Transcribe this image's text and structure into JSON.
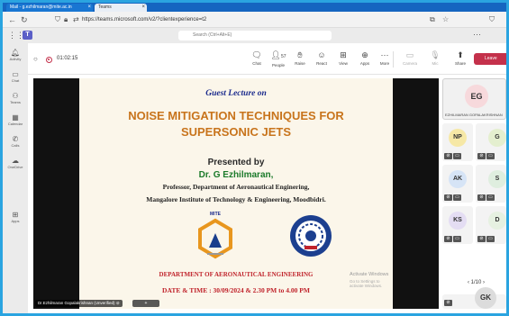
{
  "browser": {
    "tabs": [
      {
        "label": "Mail - g.ezhilmaran@mite.ac.in"
      },
      {
        "label": "Teams"
      }
    ],
    "url": "https://teams.microsoft.com/v2/?clientexperience=t2"
  },
  "teams": {
    "search_placeholder": "Search (Ctrl+Alt+E)",
    "rail": [
      {
        "label": "Activity",
        "icon": "bell-icon"
      },
      {
        "label": "Chat",
        "icon": "chat-icon"
      },
      {
        "label": "Teams",
        "icon": "teams-icon"
      },
      {
        "label": "Calendar",
        "icon": "calendar-icon"
      },
      {
        "label": "Calls",
        "icon": "phone-icon"
      },
      {
        "label": "OneDrive",
        "icon": "cloud-icon"
      },
      {
        "label": "Apps",
        "icon": "apps-icon"
      }
    ]
  },
  "meeting": {
    "timer": "01:02:15",
    "toolbar": {
      "chat": "Chat",
      "people": "People",
      "people_count": "57",
      "raise": "Raise",
      "react": "React",
      "view": "View",
      "apps": "Apps",
      "more": "More",
      "camera": "Camera",
      "mic": "Mic",
      "share": "Share",
      "leave": "Leave"
    },
    "presenter_label": "Dr.Ezhilmaran Gopalakrishnan (Unverified)",
    "stage_controls": "+",
    "participants": [
      {
        "initials": "EG",
        "name": "EZHILMARAN GOPALAKRISHNAN",
        "color": "#f7d9dc"
      },
      {
        "initials": "NP",
        "color": "#f6e8a6"
      },
      {
        "initials": "G",
        "color": "#e4efcf"
      },
      {
        "initials": "AK",
        "color": "#d6e4f6"
      },
      {
        "initials": "S",
        "color": "#dfeedf"
      },
      {
        "initials": "KS",
        "color": "#e4ddf3"
      },
      {
        "initials": "D",
        "color": "#e6f1e1"
      },
      {
        "initials": "GK",
        "color": "#dcdcdc"
      }
    ],
    "pager": "1/10"
  },
  "slide": {
    "guest": "Guest Lecture on",
    "title_line1": "NOISE MITIGATION TECHNIQUES FOR",
    "title_line2": "SUPERSONIC JETS",
    "presented_by": "Presented by",
    "presenter": "Dr. G Ezhilmaran,",
    "designation": "Professor, Department of Aeronautical Enginering,",
    "institute": "Mangalore Institute of Technology & Engineering, Moodbidri.",
    "logo_label": "MITE",
    "department": "DEPARTMENT OF AERONAUTICAL ENGINEERING",
    "datetime": "DATE & TIME : 30/09/2024 & 2.30 PM to 4.00 PM",
    "watermark_line1": "Activate Windows",
    "watermark_line2": "Go to Settings to activate Windows.",
    "colors": {
      "title": "#c8741c",
      "guest": "#1a2a8c",
      "presenter": "#1b7a2a",
      "footer": "#c0232b"
    }
  }
}
